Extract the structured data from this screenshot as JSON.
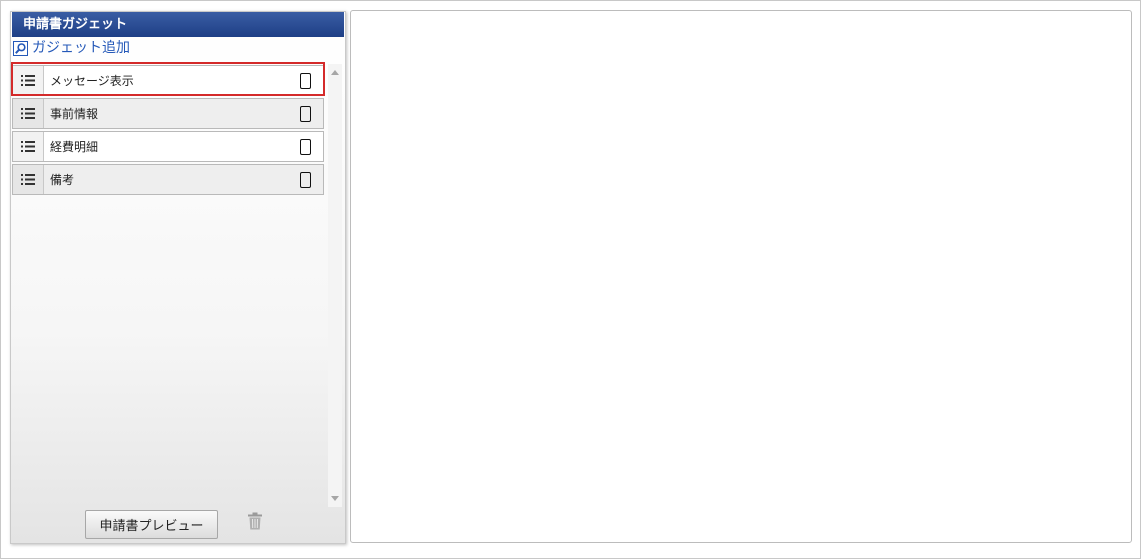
{
  "panel": {
    "title": "申請書ガジェット",
    "add_gadget_label": "ガジェット追加",
    "items": [
      {
        "label": "メッセージ表示",
        "selected": true
      },
      {
        "label": "事前情報",
        "selected": false
      },
      {
        "label": "経費明細",
        "selected": false
      },
      {
        "label": "備考",
        "selected": false
      }
    ],
    "preview_button_label": "申請書プレビュー"
  },
  "icons": {
    "add": "search-icon",
    "row_handle": "list-icon",
    "device": "smartphone-icon",
    "delete": "trash-icon"
  },
  "colors": {
    "header_bg": "#2a4d96",
    "link": "#2458b8",
    "selection_outline": "#d42a2a"
  }
}
